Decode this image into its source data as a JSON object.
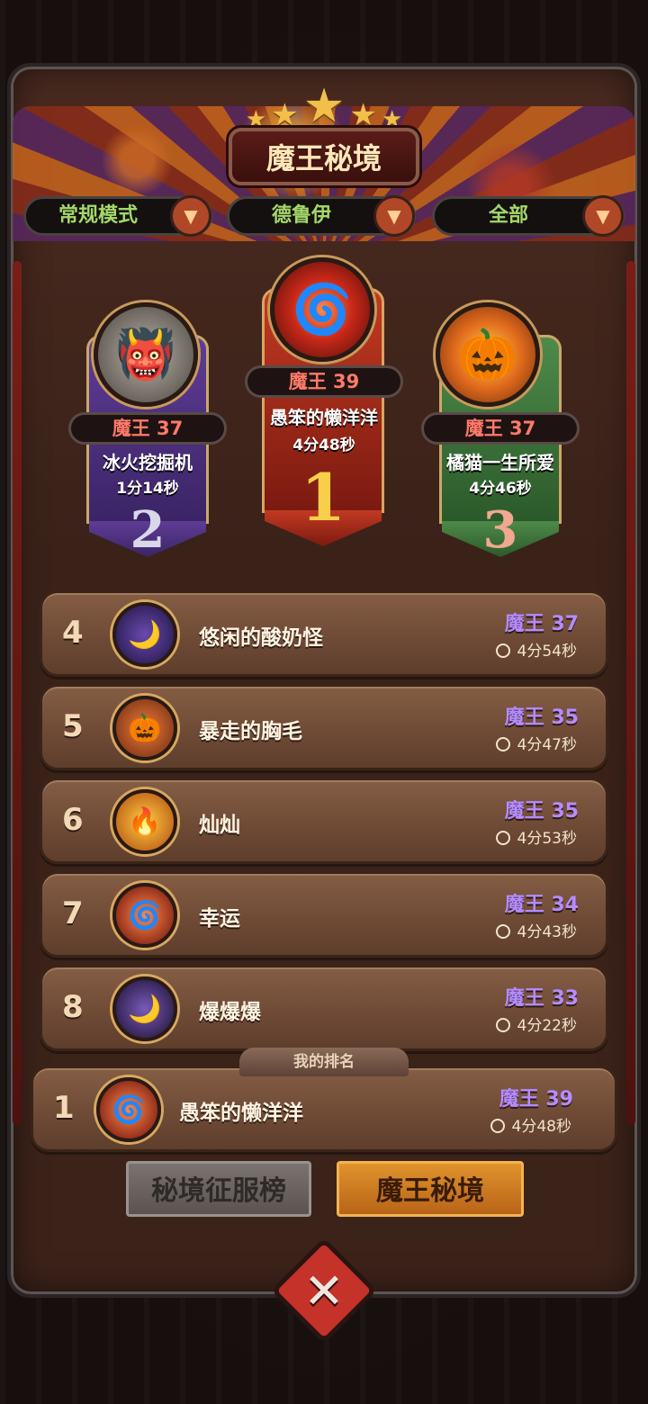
{
  "header": {
    "title": "魔王秘境",
    "stars": 5
  },
  "filters": [
    {
      "label": "常规模式"
    },
    {
      "label": "德鲁伊"
    },
    {
      "label": "全部"
    }
  ],
  "podium": {
    "first": {
      "rank": "1",
      "level": "魔王 39",
      "name": "愚笨的懒洋洋",
      "time": "4分48秒"
    },
    "second": {
      "rank": "2",
      "level": "魔王 37",
      "name": "冰火挖掘机",
      "time": "1分14秒"
    },
    "third": {
      "rank": "3",
      "level": "魔王 37",
      "name": "橘猫一生所爱",
      "time": "4分46秒"
    }
  },
  "rows": [
    {
      "rank": "4",
      "name": "悠闲的酸奶怪",
      "level": "魔王 37",
      "time": "4分54秒"
    },
    {
      "rank": "5",
      "name": "暴走的胸毛",
      "level": "魔王 35",
      "time": "4分47秒"
    },
    {
      "rank": "6",
      "name": "灿灿",
      "level": "魔王 35",
      "time": "4分53秒"
    },
    {
      "rank": "7",
      "name": "幸运",
      "level": "魔王 34",
      "time": "4分43秒"
    },
    {
      "rank": "8",
      "name": "爆爆爆",
      "level": "魔王 33",
      "time": "4分22秒"
    }
  ],
  "my_rank": {
    "label": "我的排名",
    "rank": "1",
    "name": "愚笨的懒洋洋",
    "level": "魔王 39",
    "time": "4分48秒"
  },
  "tabs": [
    {
      "label": "秘境征服榜",
      "active": false
    },
    {
      "label": "魔王秘境",
      "active": true
    }
  ],
  "colors": {
    "level_purple": "#b58bff",
    "level_red": "#ff7a6a",
    "filter_green": "#a4d86a",
    "active_tab": "#e0932c"
  },
  "icons": {
    "close": "close-icon",
    "dropdown": "chevron-down-icon",
    "clock": "clock-icon",
    "star": "star-icon"
  }
}
